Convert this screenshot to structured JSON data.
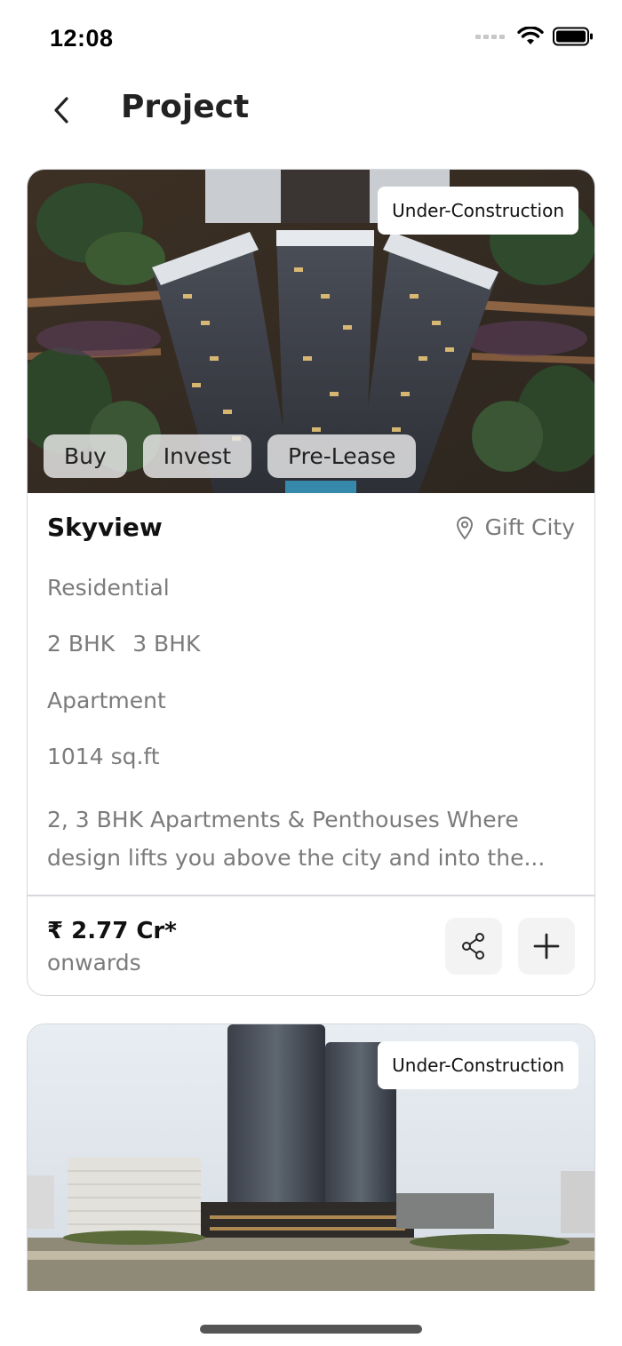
{
  "status_bar": {
    "time": "12:08",
    "icons": [
      "signal-icon",
      "wifi-icon",
      "battery-icon"
    ]
  },
  "header": {
    "back_icon": "chevron-left-icon",
    "title": "Project"
  },
  "projects": [
    {
      "status": "Under-Construction",
      "tags": [
        "Buy",
        "Invest",
        "Pre-Lease"
      ],
      "name": "Skyview",
      "location_icon": "map-pin-icon",
      "location": "Gift City",
      "category": "Residential",
      "bhk": [
        "2 BHK",
        "3 BHK"
      ],
      "type": "Apartment",
      "area": "1014 sq.ft",
      "description_line1": "2, 3 BHK Apartments & Penthouses Where",
      "description_line2": "design lifts you above the city and into the...",
      "price": "₹ 2.77 Cr*",
      "price_suffix": "onwards",
      "share_icon": "share-icon",
      "add_icon": "plus-icon"
    },
    {
      "status": "Under-Construction"
    }
  ],
  "colors": {
    "accent_text": "#111111",
    "muted_text": "#7b7b7b",
    "card_border": "#d6d8dd",
    "button_bg": "#f3f3f4"
  }
}
